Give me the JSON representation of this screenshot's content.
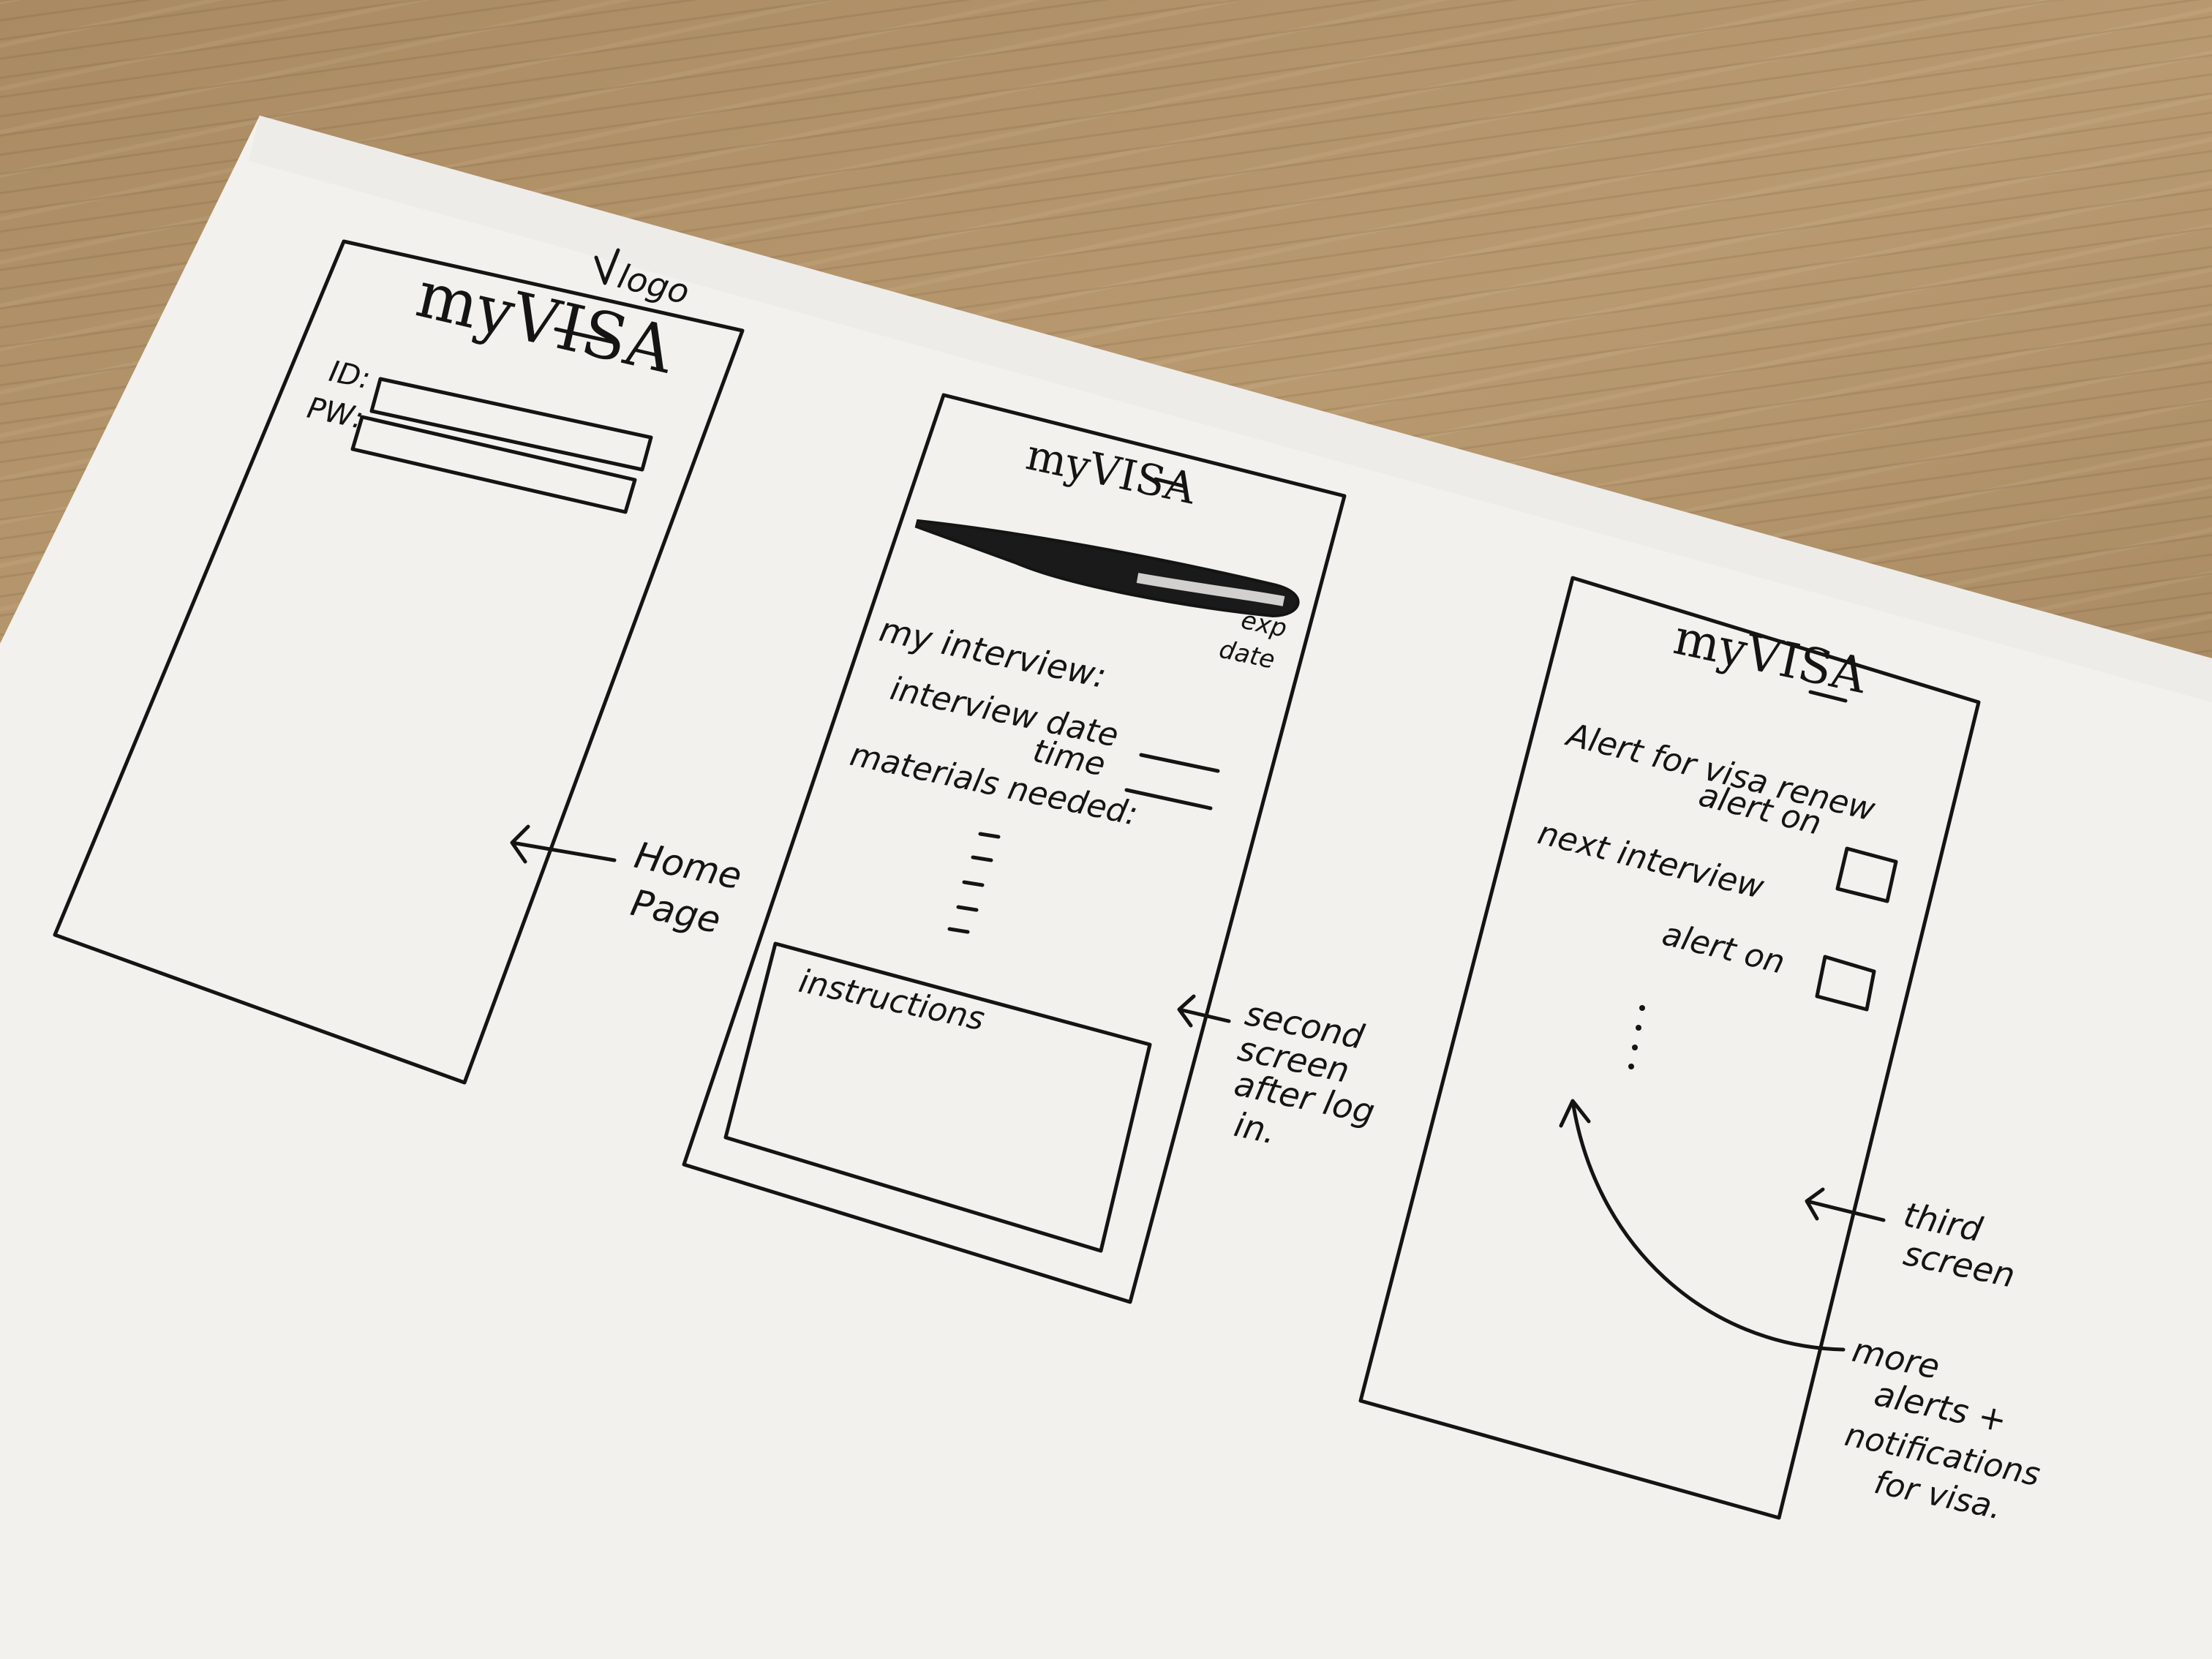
{
  "annotations": {
    "logo_note": "logo",
    "home_page": [
      "Home",
      "Page"
    ],
    "second_screen": [
      "second",
      "screen",
      "after log",
      "in."
    ],
    "third_screen": [
      "third",
      "screen"
    ],
    "more_alerts": [
      "more",
      "alerts +",
      "notifications",
      "for visa."
    ]
  },
  "screen1": {
    "logo": "myVISA",
    "id_label": "ID:",
    "pw_label": "PW:"
  },
  "screen2": {
    "logo": "myVISA",
    "exp_date": [
      "exp",
      "date"
    ],
    "my_interview": "my interview:",
    "interview_date": "interview date",
    "time": "time",
    "materials_needed": "materials needed:",
    "instructions": "instructions"
  },
  "screen3": {
    "logo": "myVISA",
    "alert_title": "Alert for visa renew",
    "alert_on_1": "alert on",
    "next_interview": "next interview",
    "alert_on_2": "alert on"
  },
  "colors": {
    "paper": "#f2f1ee",
    "ink": "#141414",
    "table": "#a98a62"
  }
}
